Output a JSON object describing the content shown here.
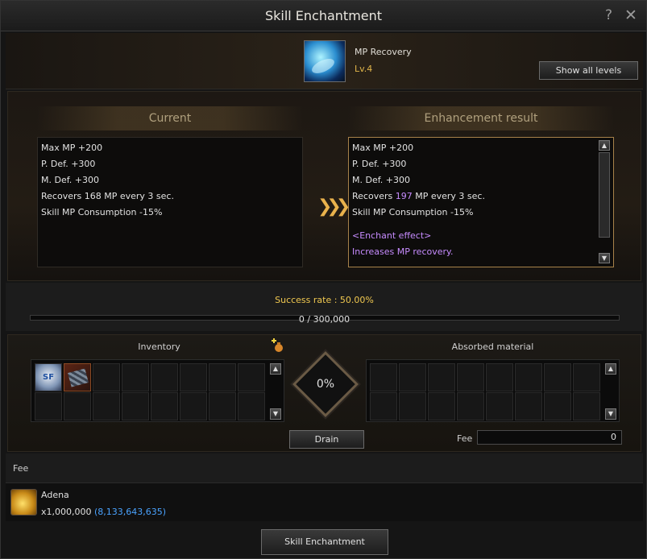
{
  "window": {
    "title": "Skill Enchantment"
  },
  "header": {
    "help_glyph": "?",
    "close_glyph": "✕",
    "skill_name": "MP Recovery",
    "skill_level": "Lv.4",
    "show_levels_label": "Show all levels"
  },
  "current": {
    "title": "Current",
    "stats": [
      "Max MP +200",
      "P. Def. +300",
      "M. Def. +300",
      "Recovers 168 MP every 3 sec.",
      "Skill MP Consumption -15%"
    ]
  },
  "result": {
    "title": "Enhancement result",
    "stats": [
      "Max MP +200",
      "P. Def. +300",
      "M. Def. +300"
    ],
    "recover_prefix": "Recovers ",
    "recover_value": "197",
    "recover_suffix": " MP every 3 sec.",
    "stat_last": "Skill MP Consumption -15%",
    "enchant_effect": "<Enchant effect>",
    "enchant_desc": "Increases MP recovery."
  },
  "progress": {
    "success_rate": "Success rate : 50.00%",
    "text": "0 / 300,000",
    "fraction": 0
  },
  "materials": {
    "inventory_title": "Inventory",
    "absorbed_title": "Absorbed material",
    "percent": "0%",
    "drain_label": "Drain",
    "fee_label": "Fee",
    "fee_value": "0",
    "inventory_items": [
      {
        "icon": "scroll-icon",
        "text": "SF"
      },
      {
        "icon": "armor-icon",
        "text": ""
      }
    ]
  },
  "fee": {
    "heading": "Fee",
    "currency": "Adena",
    "amount": "x1,000,000",
    "owned": "(8,133,643,635)"
  },
  "footer": {
    "enchant_label": "Skill Enchantment"
  },
  "colors": {
    "accent": "#e0b54a",
    "highlight": "#c78cff",
    "owned": "#4aa3ff",
    "rate": "#f0c850"
  }
}
